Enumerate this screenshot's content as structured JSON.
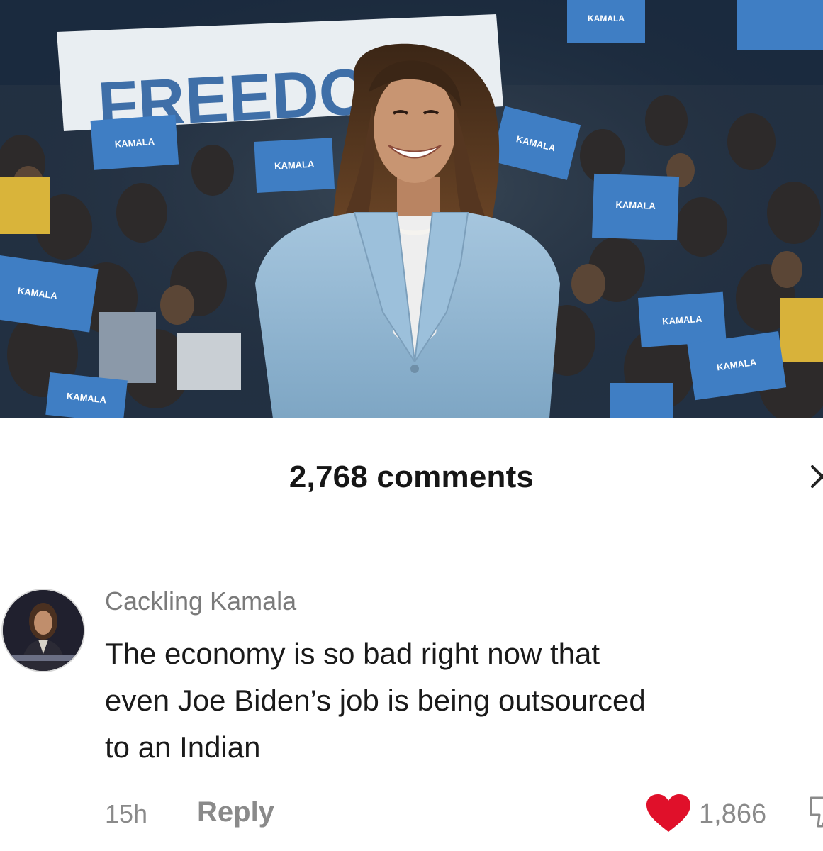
{
  "comments_panel": {
    "count_label": "2,768 comments",
    "close_icon": "close-icon"
  },
  "hero": {
    "banner_text": "FREEDOM",
    "sign_text": "KAMALA"
  },
  "comment": {
    "username": "Cackling Kamala",
    "text": "The economy is so bad right now that\neven Joe Biden’s job is being outsourced\nto an Indian",
    "timestamp": "15h",
    "reply_label": "Reply",
    "like_count": "1,866",
    "like_icon": "heart-icon",
    "like_color": "#e0102a",
    "dislike_icon": "dislike-icon"
  },
  "colors": {
    "sign_blue": "#3f7ec4",
    "suit_blue": "#8fb6d3",
    "text_primary": "#161616",
    "text_secondary": "#8a8a8a"
  }
}
